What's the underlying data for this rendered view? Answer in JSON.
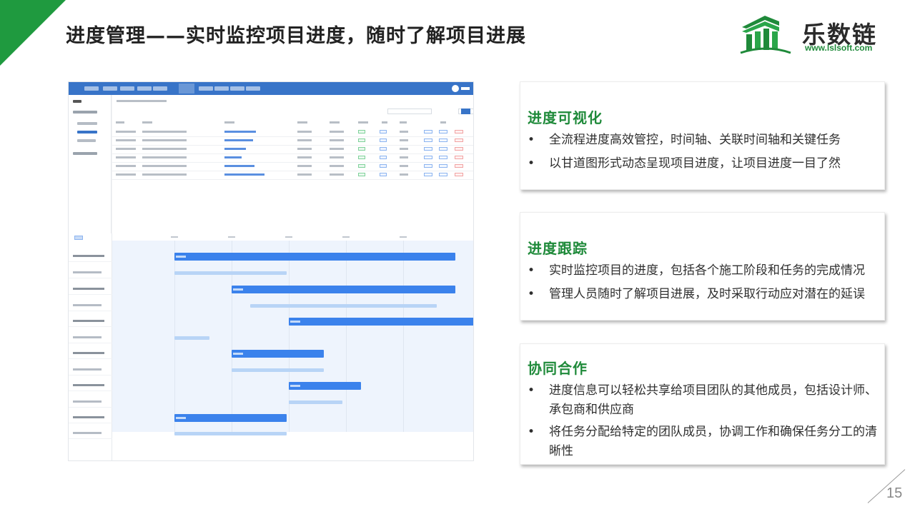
{
  "slide": {
    "title": "进度管理——实时监控项目进度，随时了解项目进展",
    "page_number": "15",
    "accent_color": "#1f9a3f"
  },
  "logo": {
    "name": "乐数链",
    "url": "www.lslsoft.com"
  },
  "cards": [
    {
      "heading": "进度可视化",
      "bullets": [
        "全流程进度高效管控，时间轴、关联时间轴和关键任务",
        "以甘道图形式动态呈现项目进度，让项目进度一目了然"
      ]
    },
    {
      "heading": "进度跟踪",
      "bullets": [
        "实时监控项目的进度，包括各个施工阶段和任务的完成情况",
        "管理人员随时了解项目进展，及时采取行动应对潜在的延误"
      ]
    },
    {
      "heading": "协同合作",
      "bullets": [
        "进度信息可以轻松共享给项目团队的其他成员，包括设计师、承包商和供应商",
        "将任务分配给特定的团队成员，协调工作和确保任务分工的清晰性"
      ]
    }
  ],
  "bullet_symbol": "•"
}
